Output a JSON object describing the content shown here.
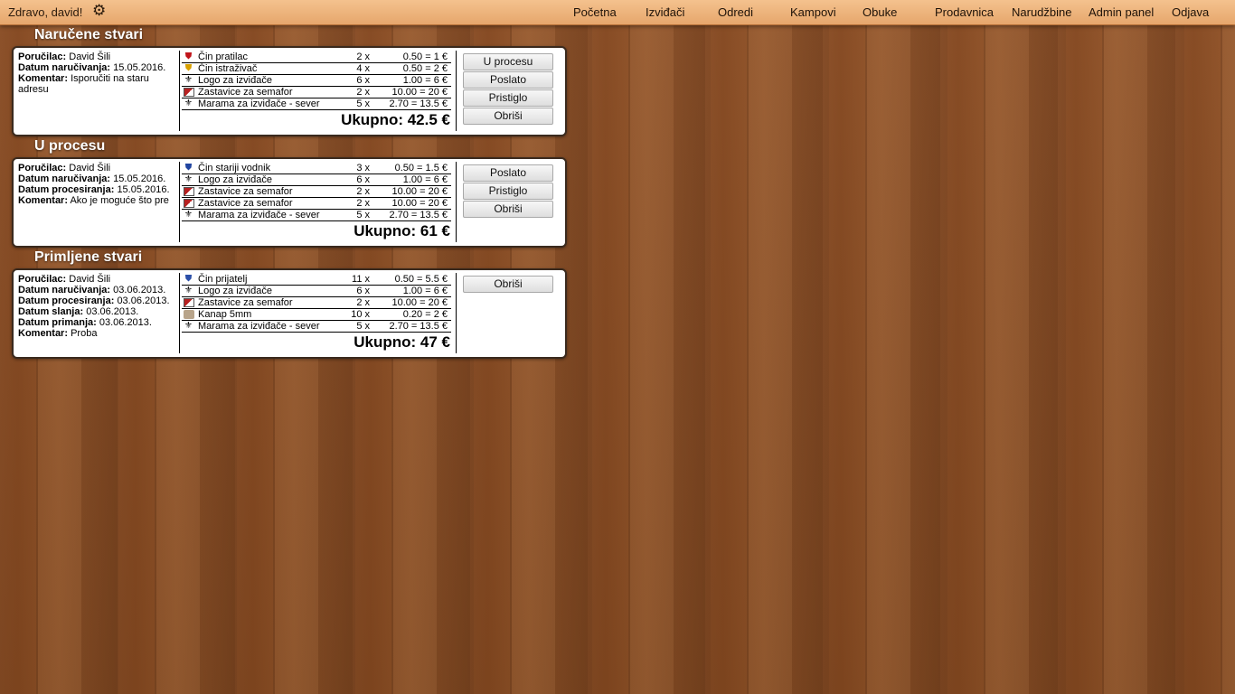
{
  "topbar": {
    "greeting": "Zdravo, david!",
    "settings_icon": "gear-icon",
    "nav": [
      "Početna",
      "Izviđači",
      "Odredi",
      "Kampovi",
      "Obuke",
      "Prodavnica",
      "Narudžbine",
      "Admin panel",
      "Odjava"
    ]
  },
  "sections": [
    {
      "title": "Naručene stvari",
      "order": {
        "fields": [
          {
            "label": "Poručilac:",
            "value": "David Šili"
          },
          {
            "label": "Datum naručivanja:",
            "value": "15.05.2016."
          },
          {
            "label": "Komentar:",
            "value": "Isporučiti na staru adresu"
          }
        ],
        "items": [
          {
            "icon": "shield-red-icon",
            "name": "Čin pratilac",
            "qty": "2 x",
            "price": "0.50 = 1 €"
          },
          {
            "icon": "shield-gold-icon",
            "name": "Čin istraživač",
            "qty": "4 x",
            "price": "0.50 = 2 €"
          },
          {
            "icon": "scout-logo-icon",
            "name": "Logo za izviđače",
            "qty": "6 x",
            "price": "1.00 = 6 €"
          },
          {
            "icon": "flag-icon",
            "name": "Zastavice za semafor",
            "qty": "2 x",
            "price": "10.00 = 20 €"
          },
          {
            "icon": "scarf-icon",
            "name": "Marama za izviđače - sever",
            "qty": "5 x",
            "price": "2.70 = 13.5 €"
          }
        ],
        "total": "Ukupno: 42.5 €",
        "buttons": [
          "U procesu",
          "Poslato",
          "Pristiglo",
          "Obriši"
        ]
      }
    },
    {
      "title": "U procesu",
      "order": {
        "fields": [
          {
            "label": "Poručilac:",
            "value": "David Šili"
          },
          {
            "label": "Datum naručivanja:",
            "value": "15.05.2016."
          },
          {
            "label": "Datum procesiranja:",
            "value": "15.05.2016."
          },
          {
            "label": "Komentar:",
            "value": "Ako je moguće što pre"
          }
        ],
        "items": [
          {
            "icon": "shield-multi-icon",
            "name": "Čin stariji vodnik",
            "qty": "3 x",
            "price": "0.50 = 1.5 €"
          },
          {
            "icon": "scout-logo-icon",
            "name": "Logo za izviđače",
            "qty": "6 x",
            "price": "1.00 = 6 €"
          },
          {
            "icon": "flag-icon",
            "name": "Zastavice za semafor",
            "qty": "2 x",
            "price": "10.00 = 20 €"
          },
          {
            "icon": "flag-icon",
            "name": "Zastavice za semafor",
            "qty": "2 x",
            "price": "10.00 = 20 €"
          },
          {
            "icon": "scarf-icon",
            "name": "Marama za izviđače - sever",
            "qty": "5 x",
            "price": "2.70 = 13.5 €"
          }
        ],
        "total": "Ukupno: 61 €",
        "buttons": [
          "Poslato",
          "Pristiglo",
          "Obriši"
        ]
      }
    },
    {
      "title": "Primljene stvari",
      "order": {
        "fields": [
          {
            "label": "Poručilac:",
            "value": "David Šili"
          },
          {
            "label": "Datum naručivanja:",
            "value": "03.06.2013."
          },
          {
            "label": "Datum procesiranja:",
            "value": "03.06.2013."
          },
          {
            "label": "Datum slanja:",
            "value": "03.06.2013."
          },
          {
            "label": "Datum primanja:",
            "value": "03.06.2013."
          },
          {
            "label": "Komentar:",
            "value": "Proba"
          }
        ],
        "items": [
          {
            "icon": "shield-blue-icon",
            "name": "Čin prijatelj",
            "qty": "11 x",
            "price": "0.50 = 5.5 €"
          },
          {
            "icon": "scout-logo-icon",
            "name": "Logo za izviđače",
            "qty": "6 x",
            "price": "1.00 = 6 €"
          },
          {
            "icon": "flag-icon",
            "name": "Zastavice za semafor",
            "qty": "2 x",
            "price": "10.00 = 20 €"
          },
          {
            "icon": "rope-icon",
            "name": "Kanap 5mm",
            "qty": "10 x",
            "price": "0.20 = 2 €"
          },
          {
            "icon": "scarf-icon",
            "name": "Marama za izviđače - sever",
            "qty": "5 x",
            "price": "2.70 = 13.5 €"
          }
        ],
        "total": "Ukupno: 47 €",
        "buttons": [
          "Obriši"
        ]
      }
    }
  ]
}
